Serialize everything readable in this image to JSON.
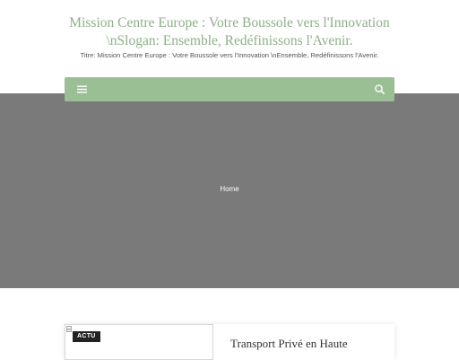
{
  "header": {
    "site_title": "Mission Centre Europe : Votre Boussole vers l'Innovation \\nSlogan: Ensemble, Redéfinissons l'Avenir.",
    "tagline": "Titre: Mission Centre Europe : Votre Boussole vers l'Innovation \\nEnsemble, Redéfinissons l'Avenir."
  },
  "nav": {
    "menu_icon": "hamburger-icon",
    "search_icon": "search-icon",
    "bar_color": "#9bbf94"
  },
  "hero": {
    "breadcrumb": "Home",
    "background_color": "#7a7a7a"
  },
  "posts": [
    {
      "category": "ACTU",
      "title": "Transport Privé en Haute"
    }
  ],
  "colors": {
    "accent": "#8fb08a",
    "badge_bg": "#222222"
  }
}
